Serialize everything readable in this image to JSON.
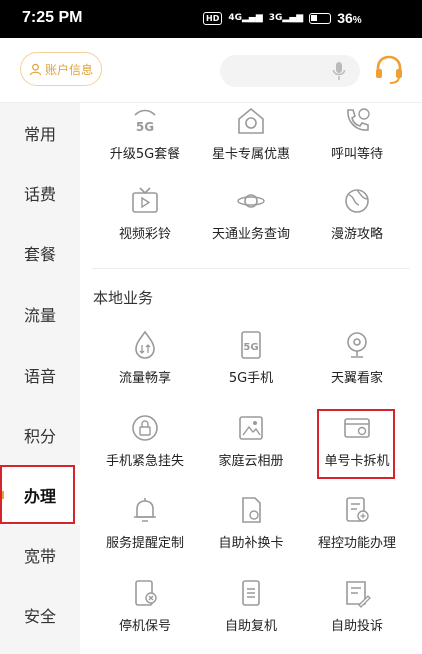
{
  "status_bar": {
    "time": "7:25 PM",
    "hd": "HD",
    "net1": "4G",
    "net2": "3G",
    "battery": "36",
    "battery_unit": "%"
  },
  "header": {
    "account_label": "账户信息",
    "icons": [
      "user-icon",
      "mic-icon",
      "headset-icon"
    ]
  },
  "sidebar": {
    "items": [
      {
        "label": "常用"
      },
      {
        "label": "话费"
      },
      {
        "label": "套餐"
      },
      {
        "label": "流量"
      },
      {
        "label": "语音"
      },
      {
        "label": "积分"
      },
      {
        "label": "办理",
        "active": true
      },
      {
        "label": "宽带"
      },
      {
        "label": "安全"
      }
    ]
  },
  "top_items": [
    {
      "label": "升级5G套餐",
      "icon": "5g-icon"
    },
    {
      "label": "星卡专属优惠",
      "icon": "star-card-icon"
    },
    {
      "label": "呼叫等待",
      "icon": "call-wait-icon"
    },
    {
      "label": "视频彩铃",
      "icon": "tv-icon"
    },
    {
      "label": "天通业务查询",
      "icon": "satellite-icon"
    },
    {
      "label": "漫游攻略",
      "icon": "globe-icon"
    }
  ],
  "local_section": {
    "title": "本地业务",
    "items": [
      {
        "label": "流量畅享",
        "icon": "data-drop-icon"
      },
      {
        "label": "5G手机",
        "icon": "5g-phone-icon"
      },
      {
        "label": "天翼看家",
        "icon": "camera-icon"
      },
      {
        "label": "手机紧急挂失",
        "icon": "lock-icon"
      },
      {
        "label": "家庭云相册",
        "icon": "photo-icon"
      },
      {
        "label": "单号卡拆机",
        "icon": "card-settings-icon",
        "highlighted": true
      },
      {
        "label": "服务提醒定制",
        "icon": "bell-icon"
      },
      {
        "label": "自助补换卡",
        "icon": "sim-icon"
      },
      {
        "label": "程控功能办理",
        "icon": "doc-add-icon"
      },
      {
        "label": "停机保号",
        "icon": "phone-stop-icon"
      },
      {
        "label": "自助复机",
        "icon": "phone-resume-icon"
      },
      {
        "label": "自助投诉",
        "icon": "complaint-icon"
      }
    ]
  },
  "colors": {
    "accent": "#f0a030",
    "highlight": "#d9232b",
    "icon_gray": "#9a9a9a"
  }
}
